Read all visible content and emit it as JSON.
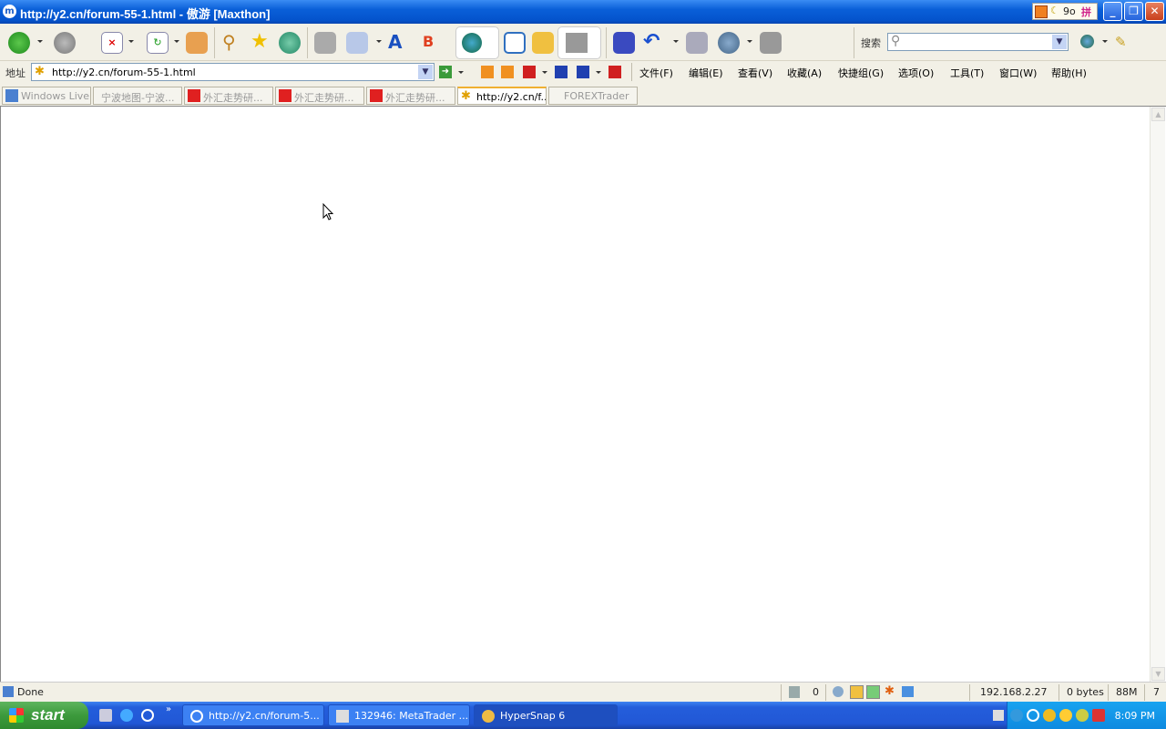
{
  "window": {
    "title": "http://y2.cn/forum-55-1.html - 傲游 [Maxthon]",
    "ime": [
      "9o",
      "拼"
    ]
  },
  "toolbar": {
    "search_label": "搜索",
    "icons": [
      "back-icon",
      "forward-icon",
      "stop-icon",
      "refresh-icon",
      "home-icon",
      "search-icon",
      "favorites-icon",
      "history-icon",
      "print-icon",
      "mail-icon",
      "font-icon",
      "translate-icon",
      "web-services-icon",
      "new-window-icon",
      "popup-blocker-icon",
      "proxy-icon",
      "save-icon",
      "undo-icon",
      "print-preview-icon",
      "tools-icon",
      "collect-icon"
    ]
  },
  "address": {
    "label": "地址",
    "url": "http://y2.cn/forum-55-1.html"
  },
  "menu": [
    "文件(F)",
    "编辑(E)",
    "查看(V)",
    "收藏(A)",
    "快捷组(G)",
    "选项(O)",
    "工具(T)",
    "窗口(W)",
    "帮助(H)"
  ],
  "tabs": [
    {
      "label": "Windows Live..."
    },
    {
      "label": "宁波地图-宁波..."
    },
    {
      "label": "外汇走势研..."
    },
    {
      "label": "外汇走势研..."
    },
    {
      "label": "外汇走势研..."
    },
    {
      "label": "http://y2.cn/f...",
      "active": true
    },
    {
      "label": "FOREXTrader"
    }
  ],
  "status": {
    "text": "Done",
    "count": "0",
    "ip": "192.168.2.27",
    "bytes": "0 bytes",
    "memory": "88M",
    "extra": "7"
  },
  "taskbar": {
    "start": "start",
    "tasks": [
      {
        "label": "http://y2.cn/forum-5..."
      },
      {
        "label": "132946: MetaTrader ..."
      },
      {
        "label": "HyperSnap 6",
        "active": true
      }
    ],
    "clock": "8:09 PM"
  },
  "colors": {
    "titlebar": "#0a5fd8",
    "taskbar": "#245edb",
    "start": "#3c9a3c"
  }
}
